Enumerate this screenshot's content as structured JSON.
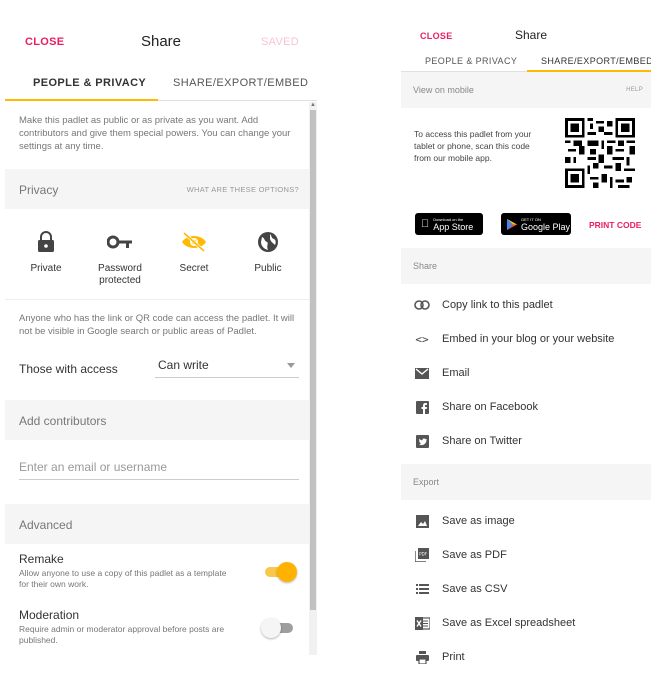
{
  "left": {
    "close": "CLOSE",
    "title": "Share",
    "saved": "SAVED",
    "tabs": [
      "PEOPLE & PRIVACY",
      "SHARE/EXPORT/EMBED"
    ],
    "intro": "Make this padlet as public or as private as you want. Add contributors and give them special powers. You can change your settings at any time.",
    "privacy": {
      "label": "Privacy",
      "help": "WHAT ARE THESE OPTIONS?",
      "options": [
        {
          "label": "Private",
          "icon": "lock-icon"
        },
        {
          "label": "Password protected",
          "icon": "key-icon"
        },
        {
          "label": "Secret",
          "icon": "eye-off-icon",
          "selected": true
        },
        {
          "label": "Public",
          "icon": "globe-icon"
        }
      ],
      "selected_color": "#ffb900"
    },
    "access_text": "Anyone who has the link or QR code can access the padlet. It will not be visible in Google search or public areas of Padlet.",
    "access_label": "Those with access",
    "access_value": "Can write",
    "contributors_label": "Add contributors",
    "email_placeholder": "Enter an email or username",
    "advanced_label": "Advanced",
    "remake": {
      "title": "Remake",
      "desc": "Allow anyone to use a copy of this padlet as a template for their own work.",
      "on": true
    },
    "moderation": {
      "title": "Moderation",
      "desc": "Require admin or moderator approval before posts are published.",
      "on": false
    }
  },
  "right": {
    "close": "CLOSE",
    "title": "Share",
    "tabs": [
      "PEOPLE & PRIVACY",
      "SHARE/EXPORT/EMBED"
    ],
    "mobile_label": "View on mobile",
    "help": "HELP",
    "mobile_text": "To access this padlet from your tablet or phone, scan this code from our mobile app.",
    "appstore_small": "Download on the",
    "appstore_big": "App Store",
    "gplay_small": "GET IT ON",
    "gplay_big": "Google Play",
    "print_code": "PRINT CODE",
    "share_label": "Share",
    "share_items": [
      {
        "label": "Copy link to this padlet",
        "icon": "link-icon"
      },
      {
        "label": "Embed in your blog or your website",
        "icon": "code-icon"
      },
      {
        "label": "Email",
        "icon": "email-icon"
      },
      {
        "label": "Share on Facebook",
        "icon": "facebook-icon"
      },
      {
        "label": "Share on Twitter",
        "icon": "twitter-icon"
      }
    ],
    "export_label": "Export",
    "export_items": [
      {
        "label": "Save as image",
        "icon": "image-icon"
      },
      {
        "label": "Save as PDF",
        "icon": "pdf-icon"
      },
      {
        "label": "Save as CSV",
        "icon": "list-icon"
      },
      {
        "label": "Save as Excel spreadsheet",
        "icon": "excel-icon"
      },
      {
        "label": "Print",
        "icon": "printer-icon"
      }
    ],
    "accent": "#e91e63"
  }
}
